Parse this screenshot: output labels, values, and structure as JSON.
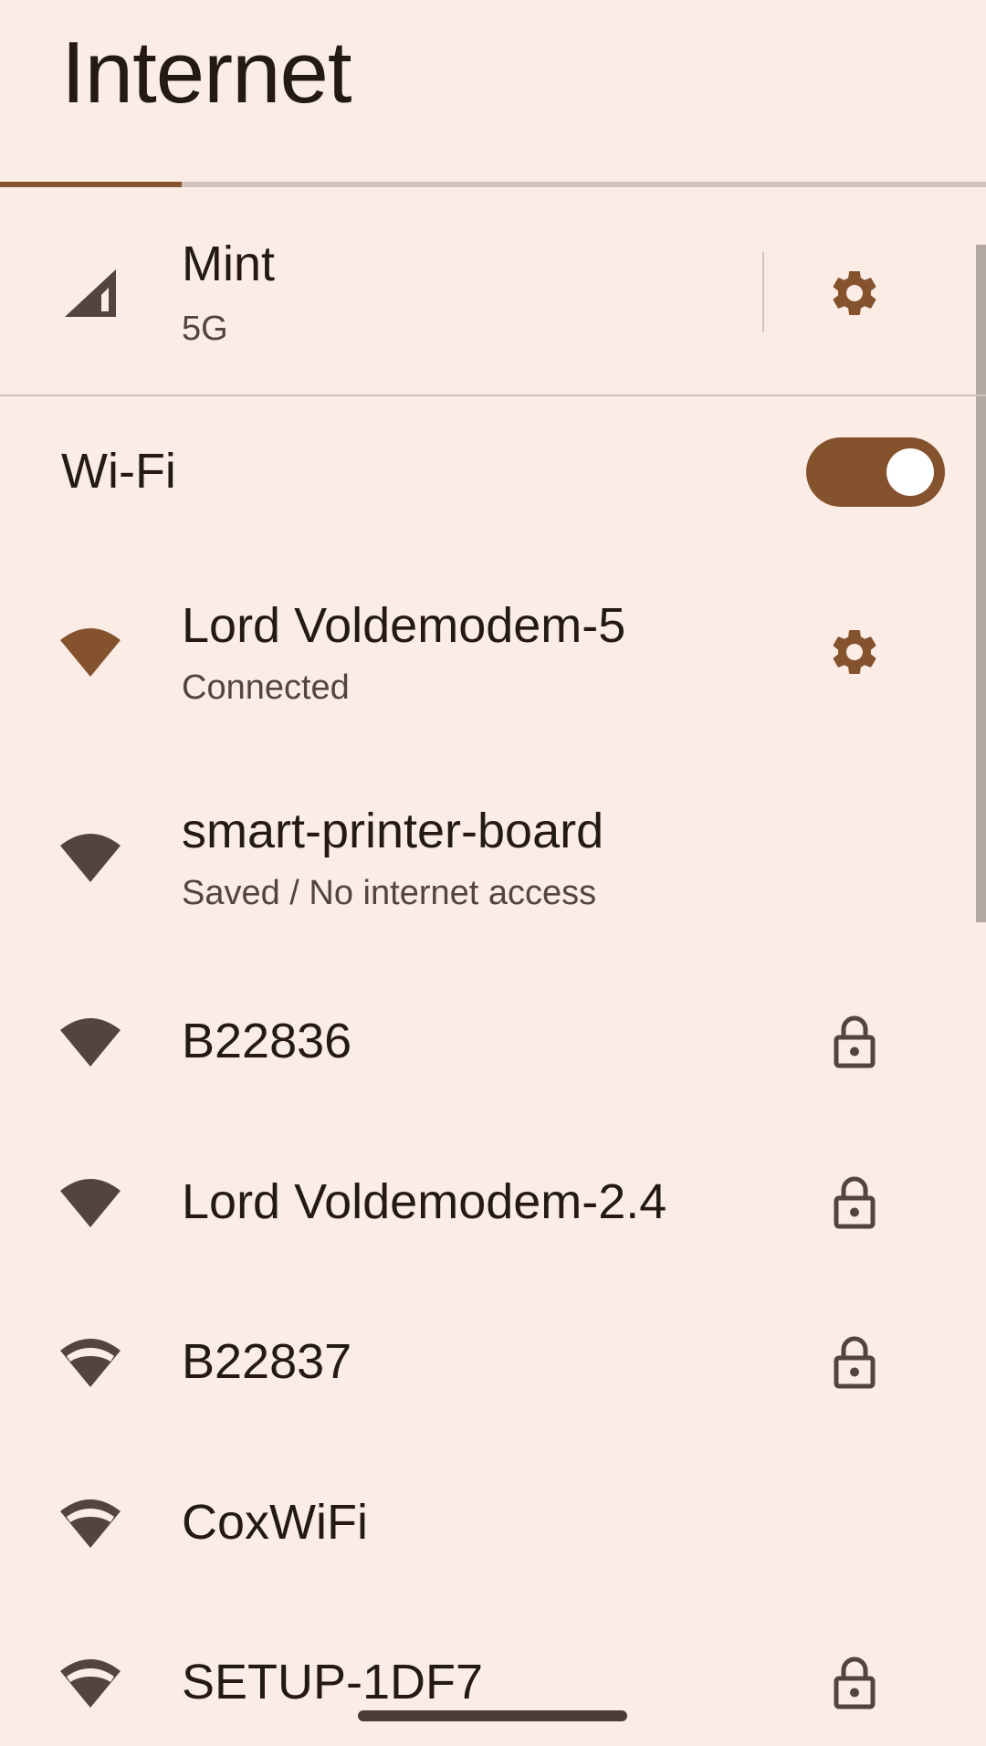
{
  "page": {
    "title": "Internet"
  },
  "mobile": {
    "name": "Mint",
    "type": "5G"
  },
  "wifi": {
    "label": "Wi-Fi",
    "enabled": true,
    "networks": [
      {
        "name": "Lord Voldemodem-5",
        "status": "Connected",
        "icon": "wifi-full-icon",
        "trailing": "gear-icon"
      },
      {
        "name": "smart-printer-board",
        "status": "Saved / No internet access",
        "icon": "wifi-full-icon",
        "trailing": ""
      },
      {
        "name": "B22836",
        "status": "",
        "icon": "wifi-full-icon",
        "trailing": "lock-icon"
      },
      {
        "name": "Lord Voldemodem-2.4",
        "status": "",
        "icon": "wifi-full-icon",
        "trailing": "lock-icon"
      },
      {
        "name": "B22837",
        "status": "",
        "icon": "wifi-medium-icon",
        "trailing": "lock-icon"
      },
      {
        "name": "CoxWiFi",
        "status": "",
        "icon": "wifi-medium-icon",
        "trailing": ""
      },
      {
        "name": "SETUP-1DF7",
        "status": "",
        "icon": "wifi-medium-icon",
        "trailing": "lock-icon"
      }
    ]
  },
  "colors": {
    "background": "#fcece6",
    "accent": "#85522e",
    "icon_dark": "#53443d",
    "text": "#231a16",
    "divider": "#d2c4bd"
  }
}
